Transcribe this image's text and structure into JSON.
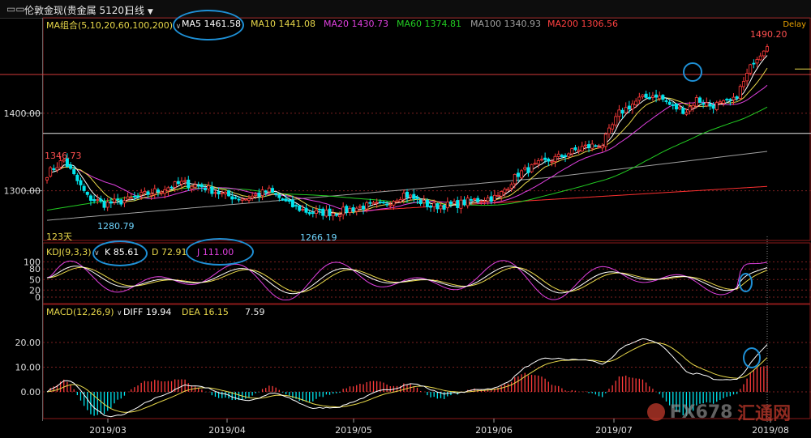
{
  "topbar": {
    "icon": "compare-icon",
    "title": "伦敦金现(贵金属 5120)",
    "period": "日线",
    "period_icon": "chevron-down-icon"
  },
  "delay_label": "Delay",
  "watermark": {
    "brand": "FX678",
    "cn": "汇通网"
  },
  "colors": {
    "bg": "#000000",
    "up": "#ff3b3b",
    "down": "#00e5ee",
    "ma5": "#ffffff",
    "ma10": "#e8d84a",
    "ma20": "#e040e0",
    "ma60": "#22cc22",
    "ma100": "#a0a0a0",
    "ma200": "#ff3030",
    "annotation": "#1e90d6"
  },
  "legend": {
    "main": {
      "name": "MA组合(5,10,20,60,100,200)",
      "ma5": "MA5 1461.58",
      "ma10": "MA10 1441.08",
      "ma20": "MA20 1430.73",
      "ma60": "MA60 1374.81",
      "ma100": "MA100 1340.93",
      "ma200": "MA200 1306.56"
    },
    "kdj": {
      "name": "KDJ(9,3,3)",
      "k": "K 85.61",
      "d": "D 72.91",
      "j": "J 111.00"
    },
    "macd": {
      "name": "MACD(12,26,9)",
      "diff": "DIFF 19.94",
      "dea": "DEA 16.15",
      "hist": "7.59"
    }
  },
  "chart_data": [
    {
      "type": "candlestick",
      "title": "伦敦金现(贵金属 5120) 日线",
      "y_ticks": [
        "1400.00",
        "1300.00"
      ],
      "ylim": [
        1236,
        1523
      ],
      "x_ticks": [
        "2019/03",
        "2019/04",
        "2019/05",
        "2019/06",
        "2019/07",
        "2019/08"
      ],
      "volume_label": "123天",
      "annotations": [
        {
          "text": "1346.73",
          "kind": "high"
        },
        {
          "text": "1280.79",
          "kind": "low"
        },
        {
          "text": "1266.19",
          "kind": "low"
        },
        {
          "text": "1490.20",
          "kind": "high"
        }
      ],
      "horizontal_levels": [
        1450,
        1374
      ],
      "series": [
        {
          "name": "MA5",
          "last": 1461.58
        },
        {
          "name": "MA10",
          "last": 1441.08
        },
        {
          "name": "MA20",
          "last": 1430.73
        },
        {
          "name": "MA60",
          "last": 1374.81
        },
        {
          "name": "MA100",
          "last": 1340.93
        },
        {
          "name": "MA200",
          "last": 1306.56
        }
      ],
      "path": [
        [
          0,
          1322
        ],
        [
          5,
          1340
        ],
        [
          12,
          1292
        ],
        [
          17,
          1283
        ],
        [
          24,
          1288
        ],
        [
          31,
          1298
        ],
        [
          40,
          1310
        ],
        [
          46,
          1306
        ],
        [
          53,
          1294
        ],
        [
          59,
          1290
        ],
        [
          66,
          1300
        ],
        [
          72,
          1282
        ],
        [
          78,
          1272
        ],
        [
          86,
          1272
        ],
        [
          94,
          1280
        ],
        [
          100,
          1282
        ],
        [
          106,
          1296
        ],
        [
          114,
          1280
        ],
        [
          121,
          1282
        ],
        [
          127,
          1288
        ],
        [
          134,
          1292
        ],
        [
          140,
          1322
        ],
        [
          147,
          1336
        ],
        [
          153,
          1345
        ],
        [
          159,
          1356
        ],
        [
          165,
          1360
        ],
        [
          170,
          1400
        ],
        [
          176,
          1418
        ],
        [
          181,
          1424
        ],
        [
          186,
          1408
        ],
        [
          190,
          1403
        ],
        [
          193,
          1418
        ],
        [
          197,
          1410
        ],
        [
          201,
          1412
        ],
        [
          204,
          1416
        ],
        [
          207,
          1440
        ],
        [
          210,
          1468
        ],
        [
          212,
          1478
        ],
        [
          214,
          1490
        ]
      ],
      "wicks": [
        1.2,
        1.0,
        0.8
      ]
    },
    {
      "type": "line",
      "title": "KDJ(9,3,3)",
      "y_ticks": [
        "100",
        "80",
        "50",
        "20",
        "0"
      ],
      "ylim": [
        -10,
        110
      ],
      "series": [
        {
          "name": "K",
          "last": 85.61
        },
        {
          "name": "D",
          "last": 72.91
        },
        {
          "name": "J",
          "last": 111.0
        }
      ]
    },
    {
      "type": "bar",
      "title": "MACD(12,26,9)",
      "y_ticks": [
        "20.00",
        "10.00",
        "0.00"
      ],
      "ylim": [
        -11,
        30
      ],
      "series": [
        {
          "name": "DIFF",
          "last": 19.94
        },
        {
          "name": "DEA",
          "last": 16.15
        },
        {
          "name": "MACD",
          "last": 7.59
        }
      ]
    }
  ]
}
